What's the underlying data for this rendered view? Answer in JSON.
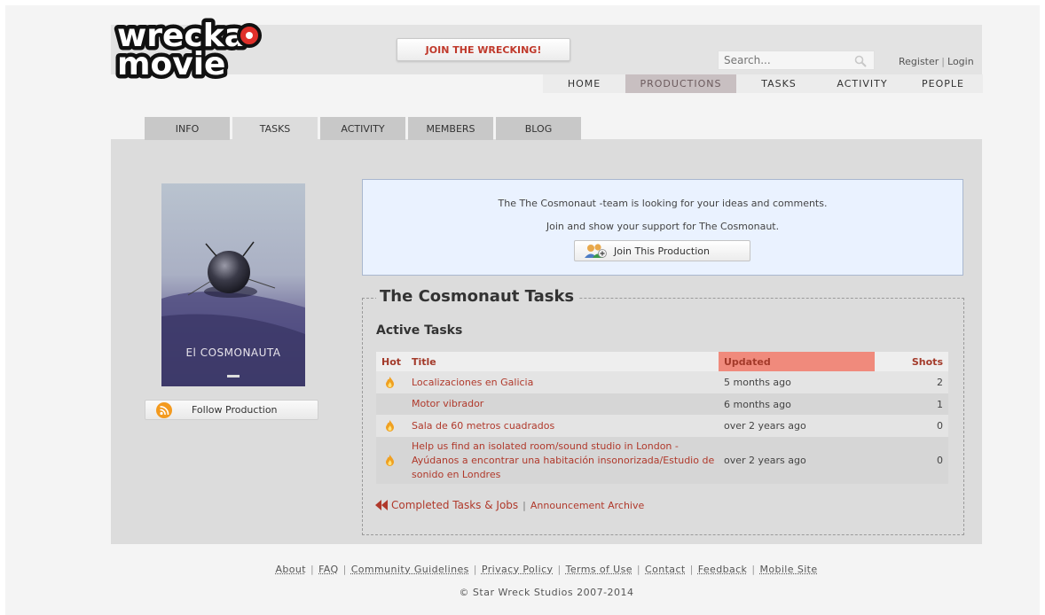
{
  "brand": {
    "logo_top": "wrecka",
    "logo_bottom": "movie"
  },
  "header": {
    "join_button": "JOIN THE WRECKING!",
    "search_placeholder": "Search...",
    "register": "Register",
    "login": "Login",
    "auth_separator": "|"
  },
  "nav": [
    {
      "label": "HOME",
      "active": false
    },
    {
      "label": "PRODUCTIONS",
      "active": true
    },
    {
      "label": "TASKS",
      "active": false
    },
    {
      "label": "ACTIVITY",
      "active": false
    },
    {
      "label": "PEOPLE",
      "active": false
    }
  ],
  "tabs": [
    {
      "label": "INFO",
      "active": false
    },
    {
      "label": "TASKS",
      "active": true
    },
    {
      "label": "ACTIVITY",
      "active": false
    },
    {
      "label": "MEMBERS",
      "active": false
    },
    {
      "label": "BLOG",
      "active": false
    }
  ],
  "poster": {
    "title": "El COSMONAUTA"
  },
  "follow": {
    "label": "Follow Production",
    "icon": "rss-icon"
  },
  "support": {
    "line1": "The The Cosmonaut -team is looking for your ideas and comments.",
    "line2": "Join and show your support for The Cosmonaut.",
    "join_button": "Join This Production"
  },
  "tasks": {
    "title": "The Cosmonaut Tasks",
    "active_heading": "Active Tasks",
    "columns": {
      "hot": "Hot",
      "title": "Title",
      "updated": "Updated",
      "shots": "Shots"
    },
    "rows": [
      {
        "hot": true,
        "title": "Localizaciones en Galicia",
        "updated": "5 months ago",
        "shots": "2"
      },
      {
        "hot": false,
        "title": "Motor vibrador",
        "updated": "6 months ago",
        "shots": "1"
      },
      {
        "hot": true,
        "title": "Sala de 60 metros cuadrados",
        "updated": "over 2 years ago",
        "shots": "0"
      },
      {
        "hot": true,
        "title": "Help us find an isolated room/sound studio in London - Ayúdanos a encontrar una habitación insonorizada/Estudio de sonido en Londres",
        "updated": "over 2 years ago",
        "shots": "0"
      }
    ],
    "completed_link": "Completed Tasks & Jobs",
    "separator": "|",
    "archive_link": "Announcement Archive"
  },
  "footer": {
    "links": [
      "About",
      "FAQ",
      "Community Guidelines",
      "Privacy Policy",
      "Terms of Use",
      "Contact",
      "Feedback",
      "Mobile Site"
    ],
    "separator": "|",
    "copyright": "© Star Wreck Studios 2007-2014"
  },
  "colors": {
    "accent_red": "#b0392b",
    "updated_header": "#f08a7c",
    "active_nav": "#c8bfc1",
    "support_bg": "#eaf2ff"
  }
}
